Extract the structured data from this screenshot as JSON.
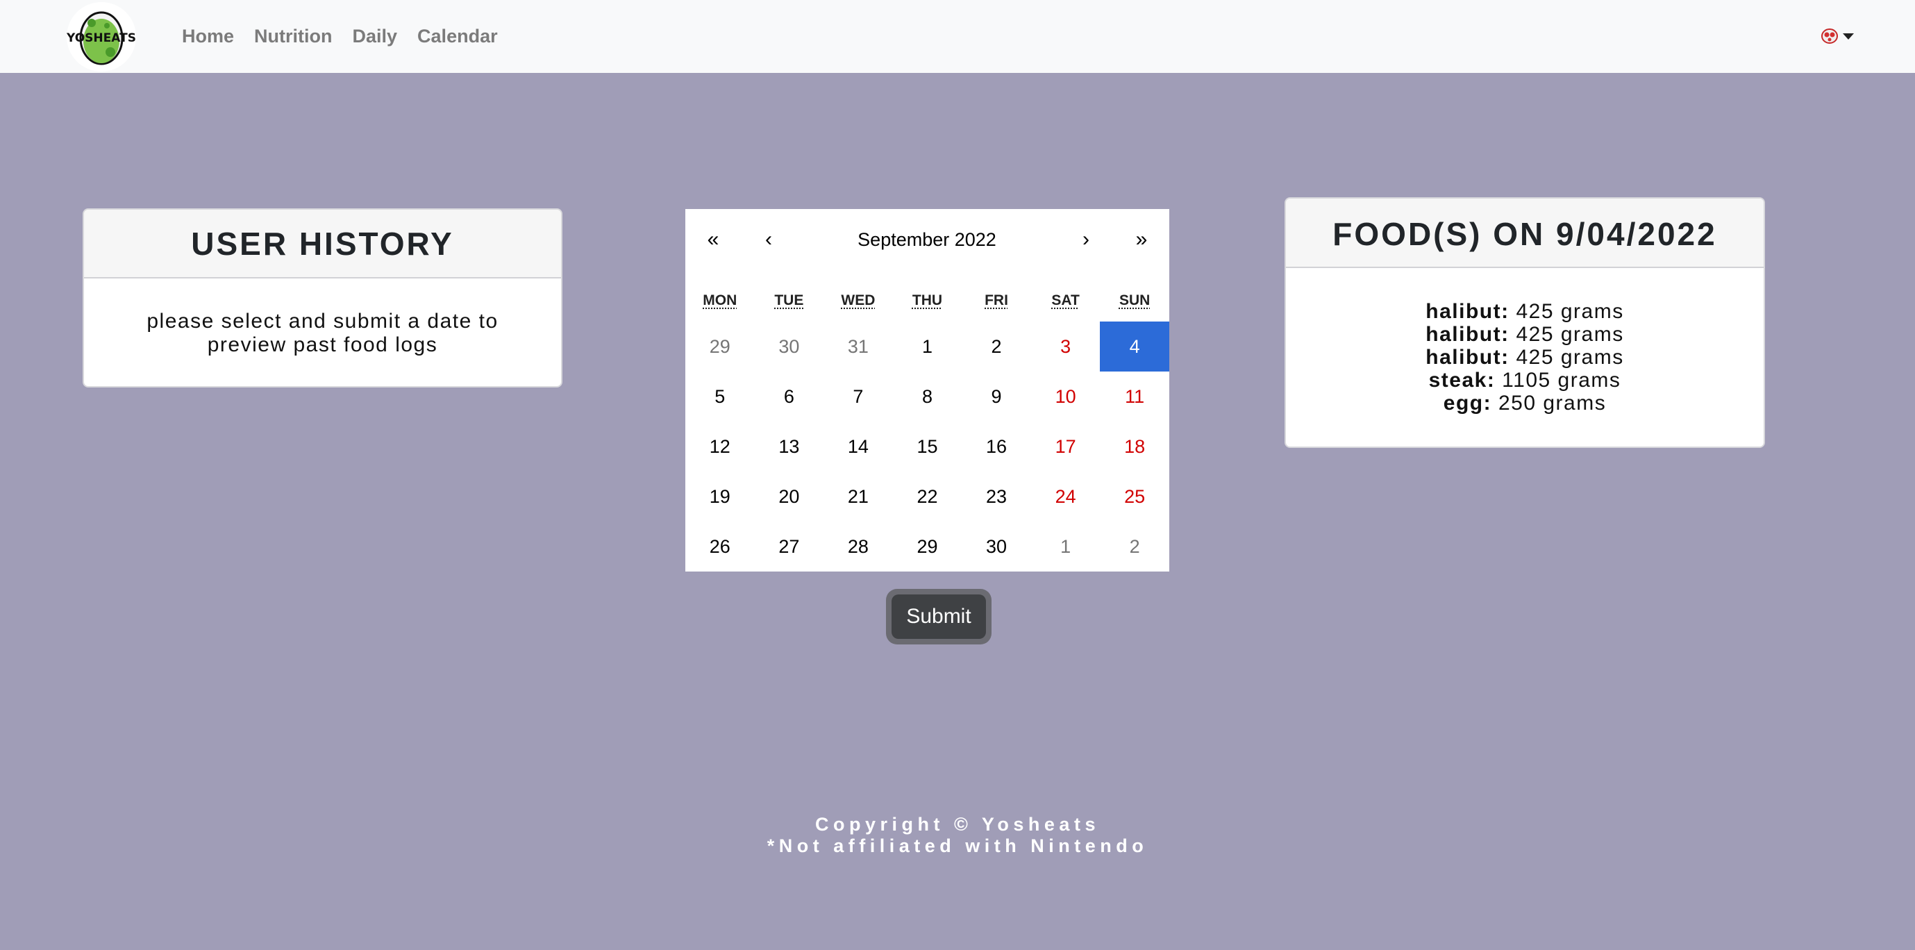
{
  "navbar": {
    "logo_text": "YOSHEATS",
    "links": [
      "Home",
      "Nutrition",
      "Daily",
      "Calendar"
    ],
    "user_icon": "yoshi-egg-avatar-icon"
  },
  "history": {
    "title": "USER HISTORY",
    "body": "please select and submit a date to preview past food logs"
  },
  "calendar": {
    "nav": {
      "prev_year": "«",
      "prev_month": "‹",
      "next_month": "›",
      "next_year": "»"
    },
    "month_label": "September 2022",
    "weekdays": [
      "MON",
      "TUE",
      "WED",
      "THU",
      "FRI",
      "SAT",
      "SUN"
    ],
    "weeks": [
      [
        "29",
        "30",
        "31",
        "1",
        "2",
        "3",
        "4"
      ],
      [
        "5",
        "6",
        "7",
        "8",
        "9",
        "10",
        "11"
      ],
      [
        "12",
        "13",
        "14",
        "15",
        "16",
        "17",
        "18"
      ],
      [
        "19",
        "20",
        "21",
        "22",
        "23",
        "24",
        "25"
      ],
      [
        "26",
        "27",
        "28",
        "29",
        "30",
        "1",
        "2"
      ]
    ],
    "selected": "4",
    "colors": {
      "selected_bg": "#2c6bd8",
      "weekend": "#d10000",
      "muted": "#757575"
    }
  },
  "submit_label": "Submit",
  "food": {
    "title": "FOOD(S) ON 9/04/2022",
    "items": [
      {
        "name": "halibut:",
        "amount": "425 grams"
      },
      {
        "name": "halibut:",
        "amount": "425 grams"
      },
      {
        "name": "halibut:",
        "amount": "425 grams"
      },
      {
        "name": "steak:",
        "amount": "1105 grams"
      },
      {
        "name": "egg:",
        "amount": "250 grams"
      }
    ]
  },
  "footer": {
    "copyright": "Copyright © Yosheats",
    "disclaimer": "*Not affiliated with Nintendo"
  },
  "colors": {
    "background": "#a09db7",
    "navbar": "#f8f9fa"
  }
}
